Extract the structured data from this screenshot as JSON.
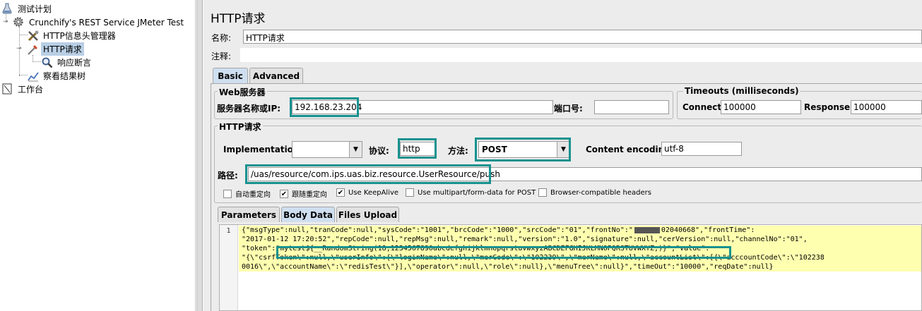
{
  "tree": {
    "root": "测试计划",
    "test_group": "Crunchify's REST Service JMeter Test",
    "header_manager": "HTTP信息头管理器",
    "http_request": "HTTP请求",
    "assertion": "响应断言",
    "result_tree": "察看结果树",
    "workbench": "工作台"
  },
  "panel": {
    "title": "HTTP请求",
    "name_label": "名称:",
    "name_value": "HTTP请求",
    "comment_label": "注释:",
    "comment_value": ""
  },
  "tabs_top": {
    "basic": "Basic",
    "advanced": "Advanced"
  },
  "web_server": {
    "group_title": "Web服务器",
    "server_label": "服务器名称或IP:",
    "server_value": "192.168.23.204",
    "port_label": "端口号:",
    "port_value": ""
  },
  "timeouts": {
    "group_title": "Timeouts (milliseconds)",
    "connect_label": "Connect:",
    "connect_value": "100000",
    "response_label": "Response:",
    "response_value": "100000"
  },
  "http_request": {
    "group_title": "HTTP请求",
    "impl_label": "Implementation:",
    "impl_value": "",
    "protocol_label": "协议:",
    "protocol_value": "http",
    "method_label": "方法:",
    "method_value": "POST",
    "encoding_label": "Content encoding:",
    "encoding_value": "utf-8",
    "path_label": "路径:",
    "path_value": "/uas/resource/com.ips.uas.biz.resource.UserResource/push"
  },
  "options": {
    "auto_redirect": "自动重定向",
    "follow_redirect": "跟随重定向",
    "keepalive": "Use KeepAlive",
    "multipart": "Use multipart/form-data for POST",
    "browser_headers": "Browser-compatible headers"
  },
  "tabs_body": {
    "parameters": "Parameters",
    "body_data": "Body Data",
    "files_upload": "Files Upload"
  },
  "editor": {
    "line_number": "1",
    "lines": [
      "{\"msgType\":null,\"tranCode\":null,\"sysCode\":\"1001\",\"brcCode\":\"1000\",\"srcCode\":\"01\",\"frontNo\":\"",
      "02040668\",\"frontTime\":",
      "\"2017-01-12 17:20:52\",\"repCode\":null,\"repMsg\":null,\"remark\":null,\"version\":\"1.0\",\"signature\":null,\"cerVersion\":null,\"channelNo\":\"01\",",
      "\"token\":",
      "\"mytest${__RandomString(18,1234567890abcdefghijklmnopqrstuvwxyzABCDEFGHIJKLMNOPQRSTUVWXYZ,)}\"",
      ",\"value\":",
      "\"{\\\"csrfToken\\\":null,\\\"userInfo\\\":{\\\"loginName\\\":null,\\\"merCode\\\":\\\"102239\\\",\\\"merName\\\":null,\\\"accountList\\\":[{\\\"acccountCode\\\":\\\"102238",
      "0016\\\",\\\"accountName\\\":\\\"redisTest\\\"}],\\\"operator\\\":null,\\\"role\\\":null},\\\"menuTree\\\":null}\",\"timeOut\":\"10000\",\"reqDate\":null}"
    ]
  },
  "colors": {
    "highlight_border": "#17928f",
    "selection": "#b8cfe5",
    "current_line": "#ffffb0"
  }
}
